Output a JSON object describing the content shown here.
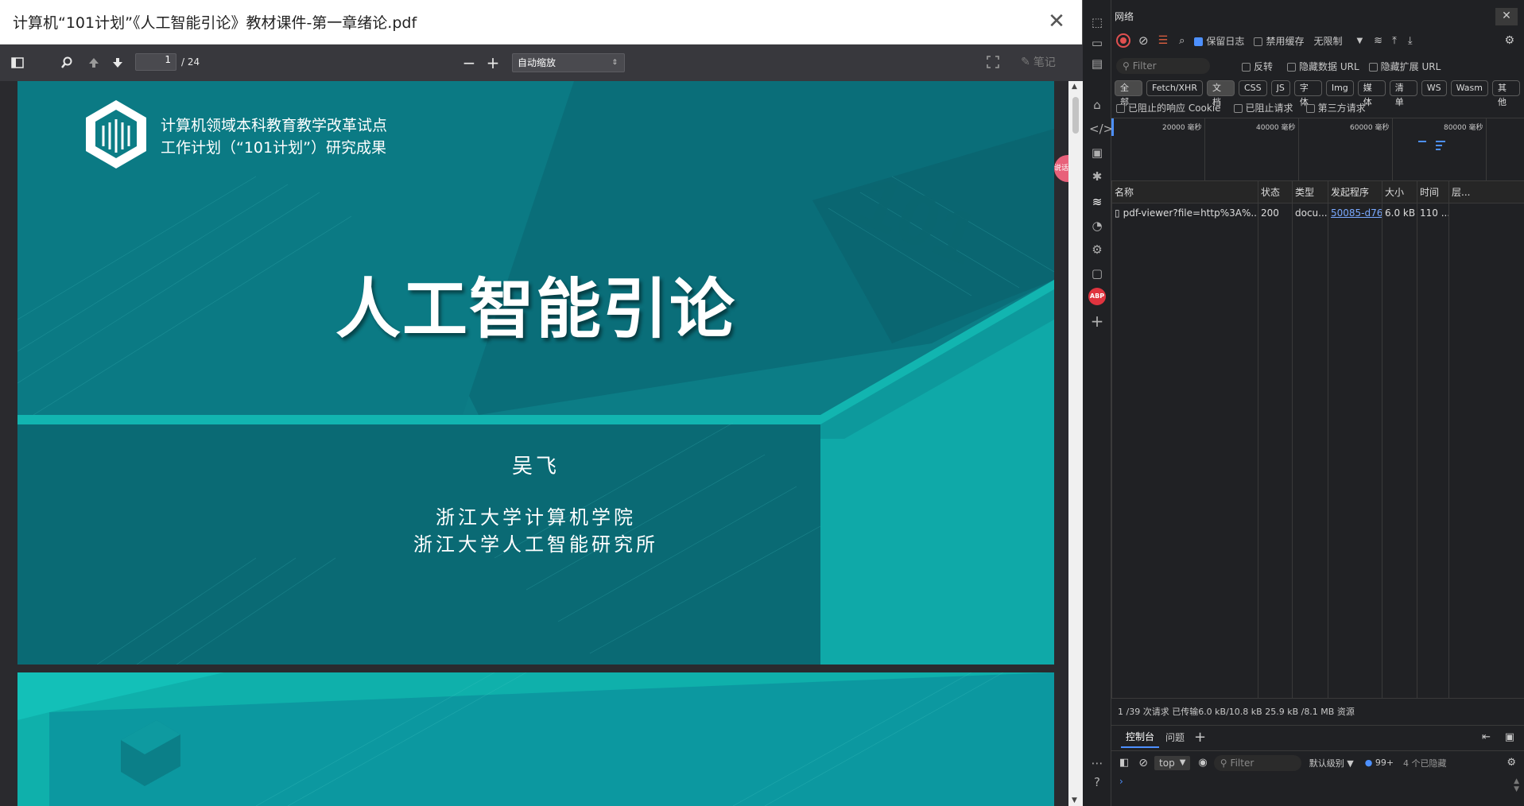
{
  "pdf": {
    "title": "计算机“101计划”《人工智能引论》教材课件-第一章绪论.pdf",
    "page_current": "1",
    "page_total": "/ 24",
    "zoom": "自动缩放",
    "notes_label": "笔记",
    "slide1": {
      "org_line1": "计算机领域本科教育教学改革试点",
      "org_line2": "工作计划（“101计划”）研究成果",
      "title": "人工智能引论",
      "author": "吴飞",
      "affil1": "浙江大学计算机学院",
      "affil2": "浙江大学人工智能研究所",
      "watermark": "101"
    },
    "side_tab": "说话"
  },
  "devtools": {
    "panel_title": "网络",
    "preserve_log": "保留日志",
    "disable_cache": "禁用缓存",
    "throttle": "无限制",
    "filter_placeholder": "Filter",
    "invert": "反转",
    "hide_data_urls": "隐藏数据 URL",
    "hide_ext_urls": "隐藏扩展 URL",
    "types": [
      "全部",
      "Fetch/XHR",
      "文档",
      "CSS",
      "JS",
      "字体",
      "Img",
      "媒体",
      "清单",
      "WS",
      "Wasm",
      "其他"
    ],
    "blocked_cookies": "已阻止的响应 Cookie",
    "blocked_requests": "已阻止请求",
    "third_party": "第三方请求",
    "timeline_ticks": [
      "20000 毫秒",
      "40000 毫秒",
      "60000 毫秒",
      "80000 毫秒"
    ],
    "columns": [
      "名称",
      "状态",
      "类型",
      "发起程序",
      "大小",
      "时间",
      "层..."
    ],
    "rows": [
      {
        "name": "pdf-viewer?file=http%3A%...",
        "status": "200",
        "type": "docu...",
        "initiator": "50085-d76e07f",
        "size": "6.0 kB",
        "time": "110 ..."
      }
    ],
    "summary": "1 /39 次请求  已传输6.0 kB/10.8 kB  25.9 kB /8.1 MB 资源",
    "drawer_tabs": [
      "控制台",
      "问题"
    ],
    "context": "top",
    "console_filter": "Filter",
    "levels": "默认级别",
    "issues_count": "99+",
    "hidden_count": "4 个已隐藏",
    "abp": "ABP"
  }
}
